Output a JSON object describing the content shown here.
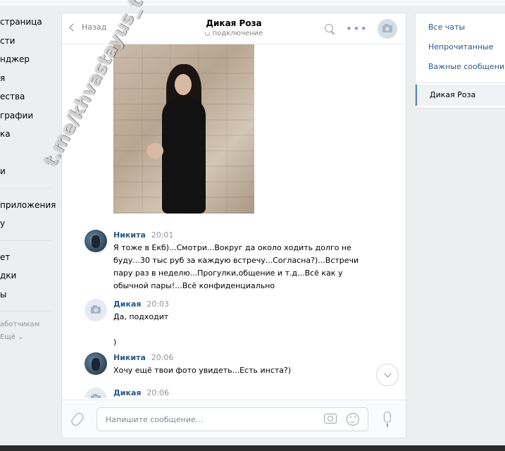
{
  "leftnav": {
    "items": [
      "страница",
      "сти",
      "нджер",
      "я",
      "ества",
      "графии",
      "ка",
      "",
      "и"
    ],
    "items2": [
      "приложения",
      "у"
    ],
    "items3": [
      "ет",
      "дки",
      "ы"
    ],
    "small": [
      "аботчикам",
      "Ещё"
    ]
  },
  "chat": {
    "back_label": "Назад",
    "title": "Дикая Роза",
    "status": "подключение"
  },
  "messages": [
    {
      "author": "Никита",
      "time": "20:01",
      "lines": [
        "Я тоже в Екб)...Смотри...Вокруг да около ходить долго не",
        "буду...30 тыс руб за каждую встречу...Согласна?)...Встречи",
        "пару раз в неделю...Прогулки,общение и т.д...Всё как у",
        "обычной пары!...Всё конфиденциально"
      ]
    },
    {
      "author": "Дикая",
      "time": "20:03",
      "lines": [
        "Да, подходит",
        "",
        ")"
      ]
    },
    {
      "author": "Никита",
      "time": "20:06",
      "lines": [
        "Хочу ещё твои фото увидеть...Есть инста?)"
      ]
    },
    {
      "author": "Дикая",
      "time": "20:06",
      "lines": []
    }
  ],
  "composer": {
    "placeholder": "Напишите сообщение..."
  },
  "right": {
    "filters": [
      "Все чаты",
      "Непрочитанные",
      "Важные сообщения"
    ],
    "conversation": "Дикая Роза"
  },
  "watermark": "t.me/khvastayus_telom"
}
